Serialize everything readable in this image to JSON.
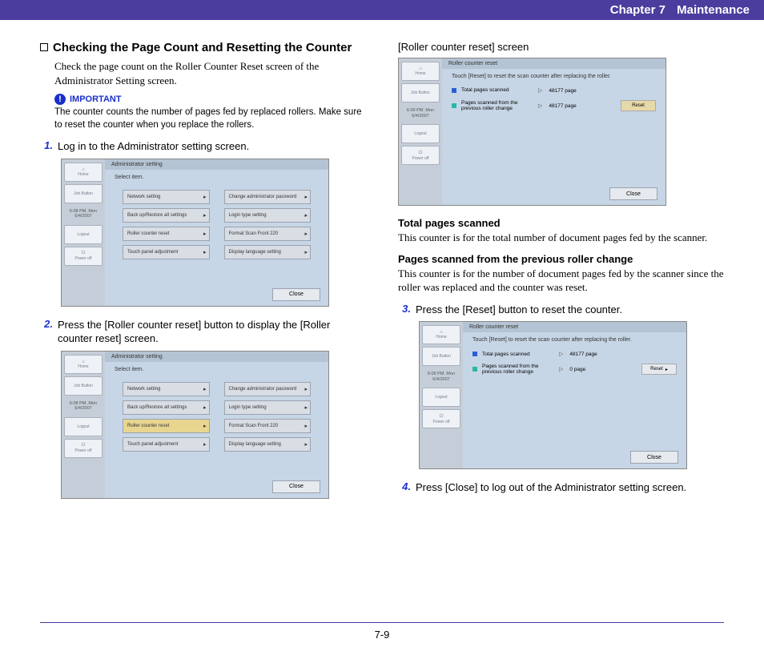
{
  "header": {
    "chapter": "Chapter 7",
    "title": "Maintenance"
  },
  "page_number": "7-9",
  "section": {
    "title": "Checking the Page Count and Resetting the Counter",
    "body": "Check the page count on the Roller Counter Reset screen of the Administrator Setting screen."
  },
  "important": {
    "label": "IMPORTANT",
    "text": "The counter counts the number of pages fed by replaced rollers. Make sure to reset the counter when you replace the rollers."
  },
  "steps": {
    "s1": "Log in to the Administrator setting screen.",
    "s2": "Press the [Roller counter reset] button to display the [Roller counter reset] screen.",
    "s3": "Press the [Reset] button to reset the counter.",
    "s4": "Press [Close] to log out of the Administrator setting screen."
  },
  "rcr_caption": "[Roller counter reset] screen",
  "defs": {
    "total_h": "Total pages scanned",
    "total_b": "This counter is for the total number of document pages fed by the scanner.",
    "prev_h": "Pages scanned from the previous roller change",
    "prev_b": "This counter is for the number of document pages fed by the scanner since the roller was replaced and the counter was reset."
  },
  "shot": {
    "sidebar": {
      "home": "Home",
      "job": "Job Button",
      "logout": "Logout",
      "poweroff": "Power off",
      "time_l1": "6:08 PM. Mon",
      "time_l2": "6/4/2007",
      "time2_l1": "6:09 PM. Mon",
      "time2_l2": "6/4/2007"
    },
    "admin_title": "Administrator setting",
    "rcr_title": "Roller counter reset",
    "select_item": "Select item.",
    "rcr_instr": "Touch [Reset] to reset the scan counter after replacing the roller.",
    "menu": {
      "network": "Network setting",
      "change_pw": "Change administrator password",
      "backup": "Back up/Restore all settings",
      "login_type": "Login type setting",
      "roller_reset": "Roller counter reset",
      "format": "Format Scan Front 220",
      "touch_panel": "Touch panel adjustment",
      "display_lang": "Display language setting"
    },
    "close": "Close",
    "reset": "Reset",
    "labels": {
      "total": "Total pages scanned",
      "prev": "Pages scanned from the previous roller change"
    },
    "values": {
      "v48177": "48177 page",
      "v0": "0 page"
    }
  }
}
